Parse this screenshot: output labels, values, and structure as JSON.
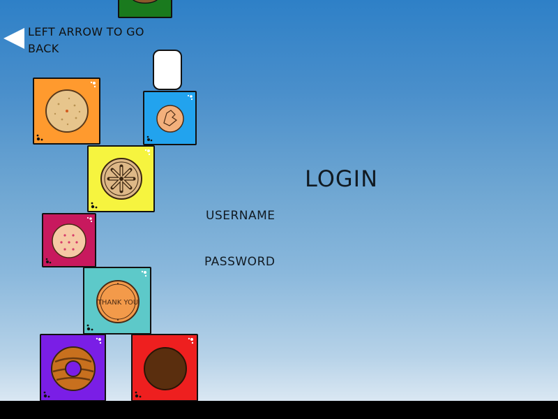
{
  "nav": {
    "back_hint": "LEFT ARROW TO GO BACK",
    "back_icon": "left-arrow-icon"
  },
  "login": {
    "title": "LOGIN",
    "username_label": "USERNAME",
    "password_label": "PASSWORD"
  },
  "tiles": [
    {
      "color": "#1a7a1e",
      "cookie": "partial-cookie"
    },
    {
      "color": "#ff9a2e",
      "cookie": "sugar-cookie"
    },
    {
      "color": "#22a3ee",
      "cookie": "cracked-cookie"
    },
    {
      "color": "#f6f43f",
      "cookie": "wheel-cookie"
    },
    {
      "color": "#c8195e",
      "cookie": "sprinkle-cookie"
    },
    {
      "color": "#5dc9c9",
      "cookie": "thank-you-cookie",
      "text": "THANK YOU"
    },
    {
      "color": "#7a1ee6",
      "cookie": "donut-cookie"
    },
    {
      "color": "#ee1f1f",
      "cookie": "chocolate-cookie"
    }
  ],
  "colors": {
    "sky_top": "#2e80c7",
    "sky_bottom": "#dbe8f3",
    "ground": "#000000",
    "text": "#111a22"
  }
}
